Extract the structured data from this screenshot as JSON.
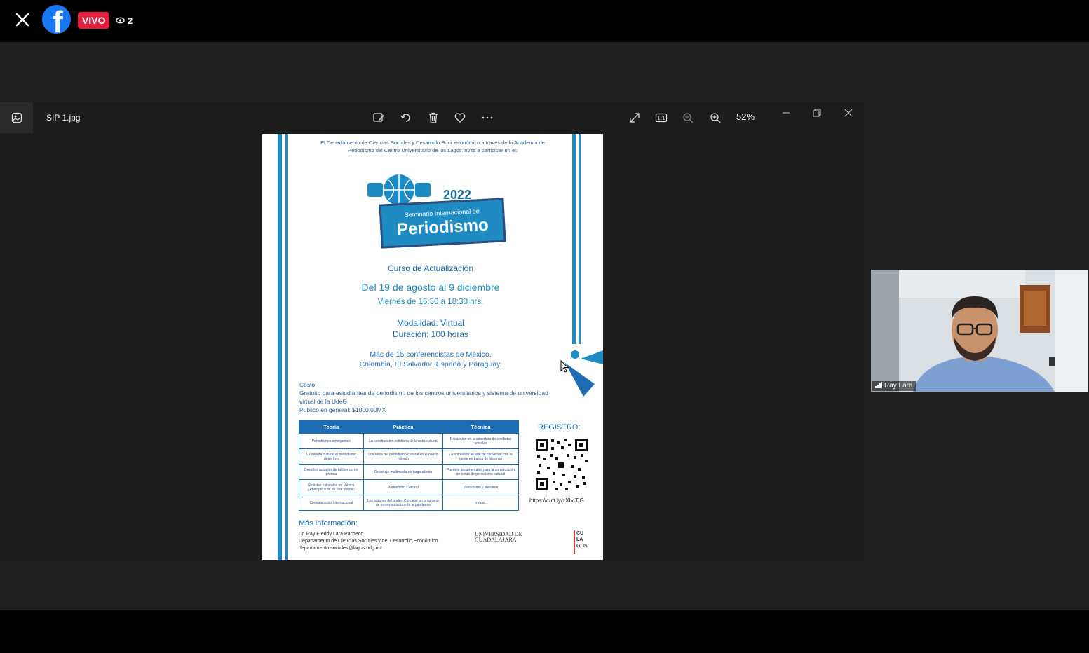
{
  "topbar": {
    "close_icon": "close-icon",
    "logo_icon": "facebook-logo",
    "live_label": "VIVO",
    "viewer_icon": "eye-icon",
    "viewer_count": "2",
    "live_color": "#e41e3f",
    "brand_color": "#1877f2"
  },
  "viewer": {
    "file_name": "SIP 1.jpg",
    "zoom_level": "52%",
    "toolbar_icons": [
      "edit-image-icon",
      "rotate-icon",
      "delete-icon",
      "favorite-icon",
      "more-icon",
      "fullscreen-icon",
      "actual-size-icon",
      "zoom-out-icon",
      "zoom-in-icon",
      "minimize-icon",
      "restore-icon",
      "close-icon"
    ]
  },
  "poster": {
    "intro": "El Departamento de Ciencias Sociales y Desarrollo Socioeconómico a través de la Academia de Periodismo del Centro Universitario de los Lagos invita a participar en el:",
    "year": "2022",
    "seminar_line": "Seminario Internacional de",
    "title": "Periodismo",
    "course": "Curso de Actualización",
    "dates": "Del 19 de agosto al 9 diciembre",
    "schedule": "Viernes de 16:30 a 18:30 hrs.",
    "modality": "Modalidad: Virtual",
    "duration": "Duración: 100 horas",
    "speakers_1": "Más de 15 conferencistas de México,",
    "speakers_2": "Colombia, El Salvador, España y Paraguay.",
    "cost_label": "Costo:",
    "cost_students": "Gratuito para estudiantes de periodismo de los centros universitarios y sistema de universidad virtual de la UdeG",
    "cost_general": "Publico en general: $1000.00MX",
    "table": {
      "headers": [
        "Teoría",
        "Práctica",
        "Técnica"
      ],
      "rows": [
        [
          "Periodismos emergentes",
          "La construcción cotidiana de la nota cultural",
          "Redacción en la cobertura de conflictos sociales"
        ],
        [
          "La mirada cultural al periodismo deportivo",
          "Los retos del periodismo cultural en el nuevo milenio",
          "La entrevista: el arte de conversar con la gente en busca de historias"
        ],
        [
          "Desafíos actuales de la libertad de prensa",
          "Reportaje multimedia de largo aliento",
          "Fuentes documentales para la construcción de notas de periodismo cultural"
        ],
        [
          "Revistas culturales en México ¿Principio o fin de una utopía?",
          "Periodismo Cultural",
          "Periodismo y literatura"
        ],
        [
          "Comunicación Internacional",
          "Los sótanos del poder: Concebir un programa de entrevistas durante la pandemia",
          "y más."
        ]
      ]
    },
    "registro": "REGISTRO:",
    "url": "https://cutt.ly/zXbcTjG",
    "mas_info": "Más información:",
    "contact_name": "Dr. Ray Freddy Lara Pacheco",
    "contact_dept": "Departamento de Ciencias Sociales y del Desarrollo Económico",
    "contact_email": "departamento.sociales@lagos.udg.mx",
    "udg_line1": "UNIVERSIDAD DE",
    "udg_line2": "GUADALAJARA",
    "cu_lagos": [
      "CU",
      "LA",
      "GOS"
    ],
    "accent_color": "#1e8bc3"
  },
  "camera": {
    "name": "Ray Lara",
    "signal_icon": "signal-bars-icon"
  }
}
